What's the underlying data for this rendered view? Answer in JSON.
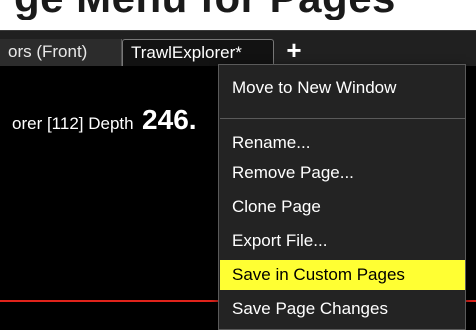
{
  "page_heading": "ge Menu for Pages",
  "tabs": [
    {
      "label": "ors (Front)",
      "active": false
    },
    {
      "label": "TrawlExplorer*",
      "active": true
    }
  ],
  "add_tab_symbol": "+",
  "readout": {
    "label": "orer [112] Depth",
    "value": "246."
  },
  "context_menu": {
    "items": [
      {
        "label": "Move to New Window",
        "highlighted": false
      },
      {
        "label": "Rename...",
        "highlighted": false
      },
      {
        "label": "Remove Page...",
        "highlighted": false
      },
      {
        "label": "Clone Page",
        "highlighted": false
      },
      {
        "label": "Export File...",
        "highlighted": false
      },
      {
        "label": "Save in Custom Pages",
        "highlighted": true
      },
      {
        "label": "Save Page Changes",
        "highlighted": false
      }
    ]
  },
  "colors": {
    "highlight": "#ffff33",
    "menu_background": "#232323",
    "content_background": "#000000",
    "red_line": "#e0231b"
  }
}
